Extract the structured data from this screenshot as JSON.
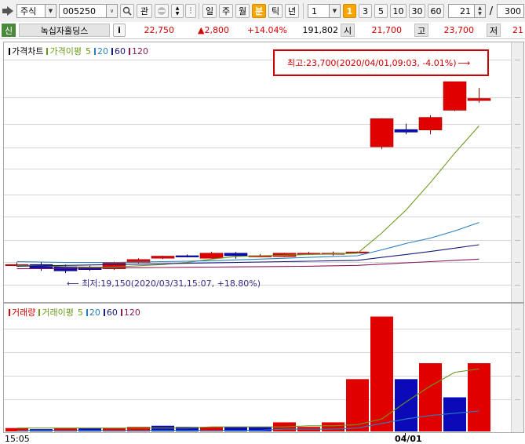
{
  "toolbar": {
    "market": "주식",
    "code": "005250",
    "btn_interest": "관",
    "periods": [
      "일",
      "주",
      "월",
      "분",
      "틱",
      "년"
    ],
    "active_period": "분",
    "interval": "1",
    "minute_options": [
      "3",
      "5",
      "10",
      "30",
      "60"
    ],
    "active_minute": "1",
    "count_value": "21",
    "slash": "/",
    "total": "300"
  },
  "quote": {
    "badge": "신",
    "name": "녹십자홀딩스",
    "info_btn": "i",
    "price": "22,750",
    "change": "▲2,800",
    "change_pct": "+14.04%",
    "volume": "191,802",
    "open_label": "시",
    "open": "21,700",
    "high_label": "고",
    "high": "23,700",
    "low_label": "저",
    "low": "21"
  },
  "price_panel": {
    "legend_price": "가격차트",
    "legend_ma_title": "가격이평",
    "ma_periods": [
      "5",
      "20",
      "60",
      "120"
    ],
    "annot_high": "최고:23,700(2020/04/01,09:03, -4.01%)",
    "annot_low": "최저:19,150(2020/03/31,15:07, +18.80%)"
  },
  "volume_panel": {
    "legend_vol": "거래량",
    "legend_ma_title": "거래이평",
    "ma_periods": [
      "5",
      "20",
      "60",
      "120"
    ]
  },
  "xaxis": {
    "left_time": "15:05",
    "date_mark": "04/01"
  },
  "colors": {
    "up": "#e00000",
    "down": "#0a0ab8",
    "ma5": "#6b9a1a",
    "ma20": "#2a7fc0",
    "ma60": "#1a1a7a",
    "ma120": "#8a1a5a"
  },
  "chart_data": [
    {
      "type": "candlestick",
      "title": "가격차트",
      "ylim": [
        19000,
        24000
      ],
      "series": [
        {
          "name": "가격차트",
          "candles": [
            {
              "o": 19350,
              "h": 19400,
              "l": 19300,
              "c": 19350
            },
            {
              "o": 19350,
              "h": 19400,
              "l": 19200,
              "c": 19250
            },
            {
              "o": 19300,
              "h": 19350,
              "l": 19150,
              "c": 19200
            },
            {
              "o": 19280,
              "h": 19320,
              "l": 19200,
              "c": 19230
            },
            {
              "o": 19250,
              "h": 19420,
              "l": 19220,
              "c": 19400
            },
            {
              "o": 19400,
              "h": 19500,
              "l": 19380,
              "c": 19470
            },
            {
              "o": 19500,
              "h": 19560,
              "l": 19480,
              "c": 19550
            },
            {
              "o": 19560,
              "h": 19590,
              "l": 19520,
              "c": 19530
            },
            {
              "o": 19500,
              "h": 19650,
              "l": 19490,
              "c": 19620
            },
            {
              "o": 19620,
              "h": 19650,
              "l": 19490,
              "c": 19560
            },
            {
              "o": 19560,
              "h": 19600,
              "l": 19540,
              "c": 19560
            },
            {
              "o": 19540,
              "h": 19630,
              "l": 19530,
              "c": 19620
            },
            {
              "o": 19620,
              "h": 19650,
              "l": 19580,
              "c": 19620
            },
            {
              "o": 19620,
              "h": 19660,
              "l": 19560,
              "c": 19620
            },
            {
              "o": 19650,
              "h": 19660,
              "l": 19640,
              "c": 19650
            },
            {
              "o": 22150,
              "h": 22830,
              "l": 22100,
              "c": 22820
            },
            {
              "o": 22560,
              "h": 22700,
              "l": 22450,
              "c": 22500
            },
            {
              "o": 22550,
              "h": 22900,
              "l": 22450,
              "c": 22850
            },
            {
              "o": 23020,
              "h": 23700,
              "l": 23000,
              "c": 23700
            },
            {
              "o": 23250,
              "h": 23550,
              "l": 23200,
              "c": 23300
            }
          ]
        },
        {
          "name": "5",
          "values": [
            19330,
            19320,
            19300,
            19290,
            19290,
            19320,
            19350,
            19400,
            19480,
            19540,
            19560,
            19570,
            19590,
            19600,
            19620,
            20100,
            20650,
            21300,
            22000,
            22650
          ]
        },
        {
          "name": "20",
          "values": [
            19420,
            19410,
            19400,
            19400,
            19400,
            19410,
            19420,
            19430,
            19440,
            19460,
            19480,
            19500,
            19520,
            19540,
            19560,
            19700,
            19850,
            19980,
            20150,
            20350
          ]
        },
        {
          "name": "60",
          "values": [
            19310,
            19320,
            19330,
            19340,
            19350,
            19360,
            19370,
            19380,
            19390,
            19400,
            19410,
            19420,
            19430,
            19440,
            19450,
            19520,
            19590,
            19660,
            19740,
            19820
          ]
        },
        {
          "name": "120",
          "values": [
            19250,
            19255,
            19260,
            19265,
            19270,
            19275,
            19280,
            19285,
            19290,
            19295,
            19300,
            19305,
            19310,
            19320,
            19330,
            19360,
            19390,
            19420,
            19450,
            19480
          ]
        }
      ]
    },
    {
      "type": "bar",
      "title": "거래량",
      "ylim": [
        0,
        100
      ],
      "series": [
        {
          "name": "거래량",
          "values": [
            3,
            2,
            3,
            3,
            3,
            4,
            5,
            4,
            4,
            4,
            4,
            8,
            4,
            8,
            46,
            101,
            46,
            60,
            30,
            60
          ],
          "colors": [
            "up",
            "down",
            "up",
            "down",
            "up",
            "up",
            "down",
            "down",
            "up",
            "down",
            "down",
            "up",
            "up",
            "up",
            "up",
            "up",
            "down",
            "up",
            "down",
            "up"
          ]
        },
        {
          "name": "5",
          "values": [
            3,
            3,
            3,
            3,
            3,
            3,
            3,
            3,
            4,
            4,
            4,
            4,
            5,
            5,
            6,
            11,
            26,
            40,
            52,
            55
          ]
        },
        {
          "name": "20",
          "values": [
            1,
            1,
            1,
            1,
            1,
            1,
            1,
            1,
            1,
            1,
            1,
            2,
            2,
            2,
            3,
            7,
            11,
            14,
            16,
            18
          ]
        }
      ]
    }
  ]
}
